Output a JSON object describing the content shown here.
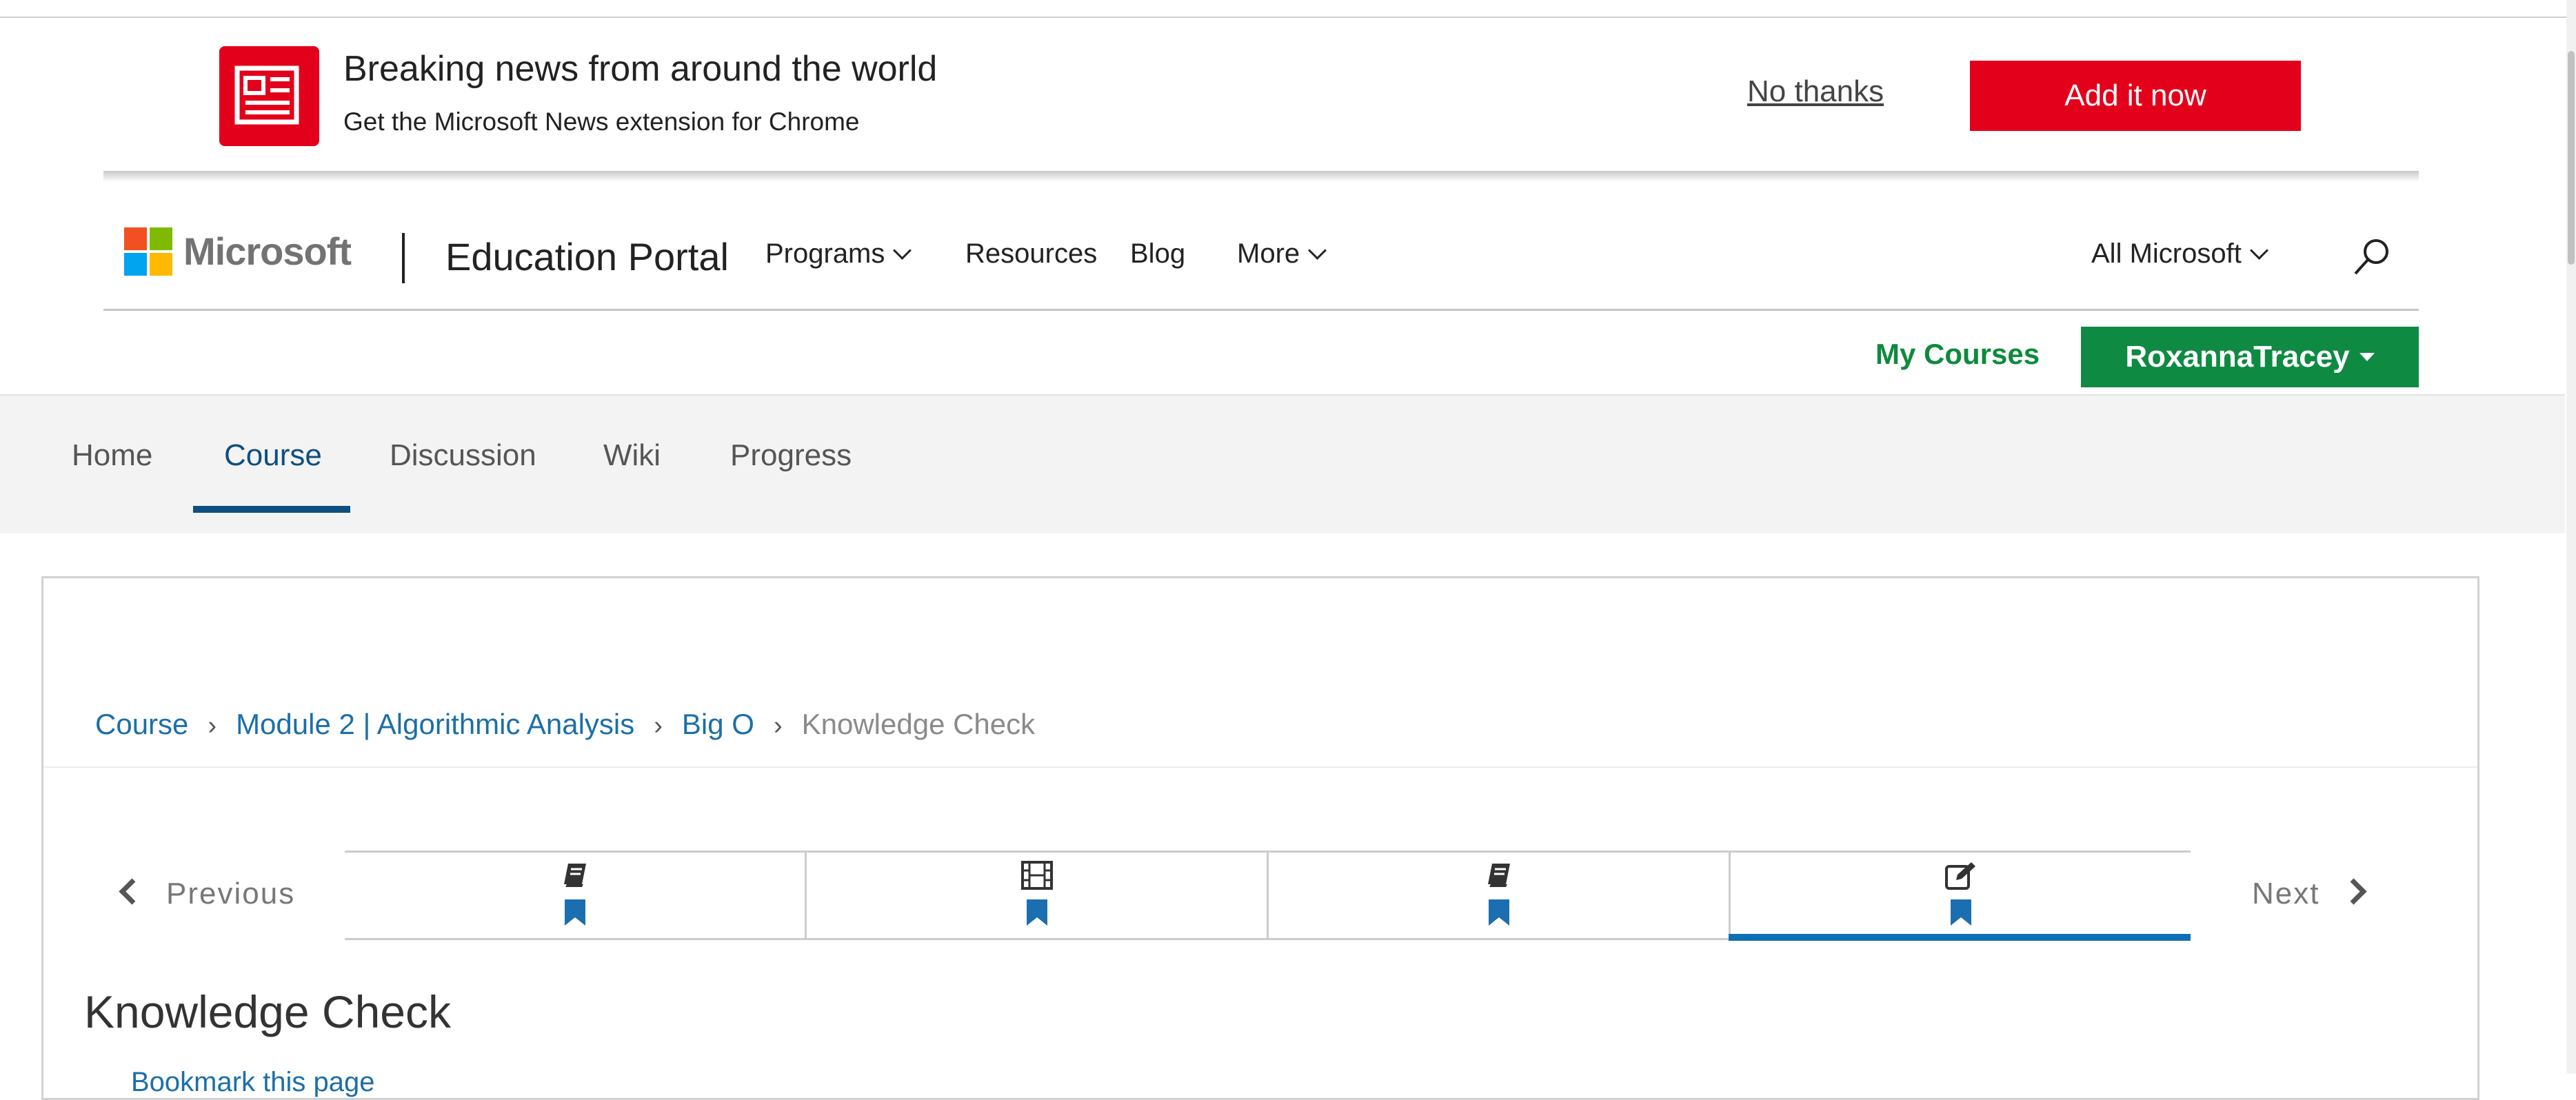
{
  "promo": {
    "title": "Breaking news from around the world",
    "subtitle": "Get the Microsoft News extension for Chrome",
    "no_thanks": "No thanks",
    "add_it_now": "Add it now",
    "accent_color": "#e3001b"
  },
  "header": {
    "brand": "Microsoft",
    "portal": "Education Portal",
    "nav": [
      {
        "label": "Programs",
        "has_dropdown": true
      },
      {
        "label": "Resources",
        "has_dropdown": false
      },
      {
        "label": "Blog",
        "has_dropdown": false
      },
      {
        "label": "More",
        "has_dropdown": true
      }
    ],
    "all_microsoft": "All Microsoft",
    "search_icon": "search-icon"
  },
  "user_bar": {
    "my_courses": "My Courses",
    "username": "RoxannaTracey",
    "accent_color": "#0f8a43"
  },
  "course_tabs": {
    "items": [
      "Home",
      "Course",
      "Discussion",
      "Wiki",
      "Progress"
    ],
    "active": "Course"
  },
  "breadcrumb": {
    "items": [
      "Course",
      "Module 2 | Algorithmic Analysis",
      "Big O"
    ],
    "current": "Knowledge Check"
  },
  "sequence": {
    "previous": "Previous",
    "next": "Next",
    "units": [
      {
        "icon": "book-icon",
        "bookmarked": true,
        "active": false
      },
      {
        "icon": "film-icon",
        "bookmarked": true,
        "active": false
      },
      {
        "icon": "book-icon",
        "bookmarked": true,
        "active": false
      },
      {
        "icon": "edit-icon",
        "bookmarked": true,
        "active": true
      }
    ]
  },
  "content": {
    "title": "Knowledge Check",
    "partial_text": "Bookmark this page"
  }
}
